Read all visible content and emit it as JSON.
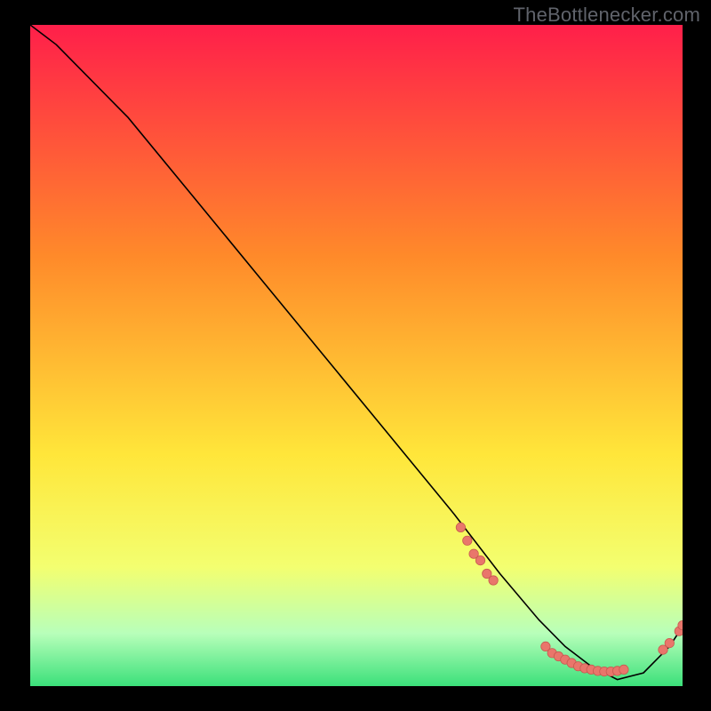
{
  "watermark": "TheBottlenecker.com",
  "colors": {
    "page_bg": "#000000",
    "curve": "#000000",
    "dot_fill": "#e9766b",
    "dot_stroke": "#c85a50",
    "grad_top": "#ff1f4a",
    "grad_mid1": "#ff8a2a",
    "grad_mid2": "#ffe63a",
    "grad_low1": "#f3ff70",
    "grad_low2": "#b8ffba",
    "grad_bottom": "#3be07a"
  },
  "chart_data": {
    "type": "line",
    "title": "",
    "xlabel": "",
    "ylabel": "",
    "xlim": [
      0,
      100
    ],
    "ylim": [
      0,
      100
    ],
    "series": [
      {
        "name": "bottleneck-curve",
        "x": [
          0,
          4,
          8,
          15,
          25,
          35,
          45,
          55,
          65,
          72,
          78,
          82,
          86,
          90,
          94,
          98,
          100
        ],
        "y": [
          100,
          97,
          93,
          86,
          74,
          62,
          50,
          38,
          26,
          17,
          10,
          6,
          3,
          1,
          2,
          6,
          9
        ]
      }
    ],
    "dot_clusters": [
      {
        "name": "cluster-descent",
        "points": [
          {
            "x": 66,
            "y": 24
          },
          {
            "x": 67,
            "y": 22
          },
          {
            "x": 68,
            "y": 20
          },
          {
            "x": 69,
            "y": 19
          },
          {
            "x": 70,
            "y": 17
          },
          {
            "x": 71,
            "y": 16
          }
        ]
      },
      {
        "name": "cluster-valley",
        "points": [
          {
            "x": 79,
            "y": 6
          },
          {
            "x": 80,
            "y": 5
          },
          {
            "x": 81,
            "y": 4.5
          },
          {
            "x": 82,
            "y": 4
          },
          {
            "x": 83,
            "y": 3.5
          },
          {
            "x": 84,
            "y": 3
          },
          {
            "x": 85,
            "y": 2.7
          },
          {
            "x": 86,
            "y": 2.5
          },
          {
            "x": 87,
            "y": 2.3
          },
          {
            "x": 88,
            "y": 2.2
          },
          {
            "x": 89,
            "y": 2.2
          },
          {
            "x": 90,
            "y": 2.3
          },
          {
            "x": 91,
            "y": 2.5
          }
        ]
      },
      {
        "name": "cluster-rise",
        "points": [
          {
            "x": 97,
            "y": 5.5
          },
          {
            "x": 98,
            "y": 6.5
          },
          {
            "x": 99.5,
            "y": 8.3
          },
          {
            "x": 100,
            "y": 9.2
          }
        ]
      }
    ]
  }
}
